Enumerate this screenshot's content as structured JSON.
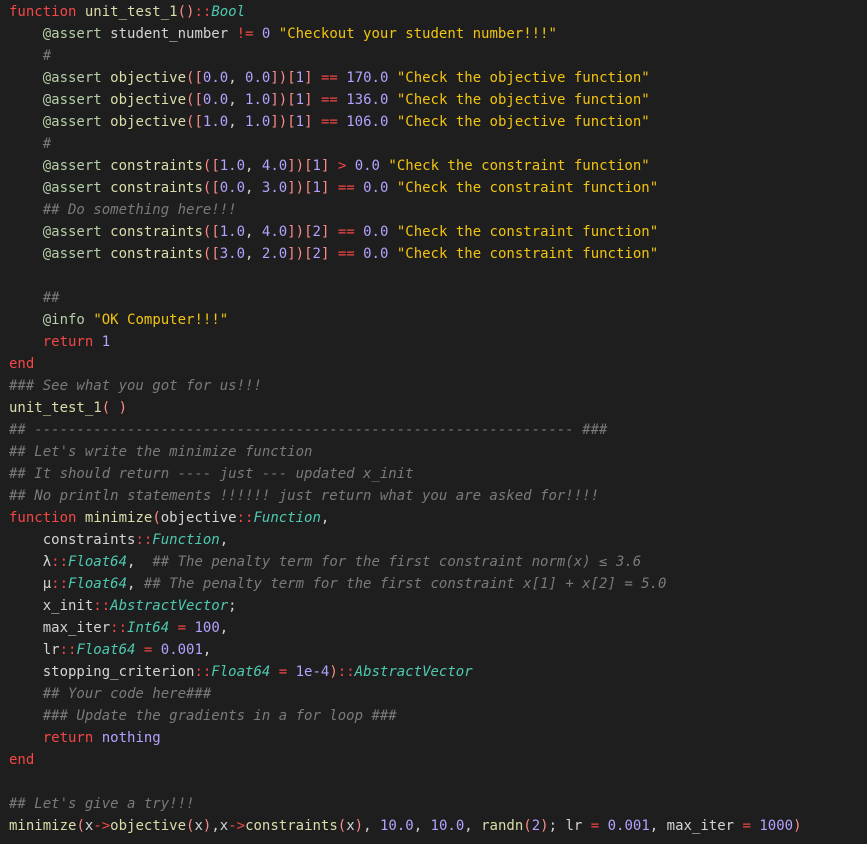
{
  "editor": {
    "language": "julia",
    "theme_colors": {
      "background": "#1e1e1e",
      "keyword": "#f44747",
      "function": "#dcdcaa",
      "type": "#4ec9b0",
      "macro": "#b5cea8",
      "string": "#f1c40f",
      "number": "#b5a1ff",
      "comment": "#7a7a7a",
      "text": "#d4d4d4"
    },
    "lines": [
      [
        [
          "kw",
          "function"
        ],
        [
          "id",
          " "
        ],
        [
          "fn",
          "unit_test_1"
        ],
        [
          "pun",
          "()"
        ],
        [
          "op",
          "::"
        ],
        [
          "typ",
          "Bool"
        ]
      ],
      [
        [
          "id",
          "    "
        ],
        [
          "mac",
          "@assert"
        ],
        [
          "id",
          " student_number "
        ],
        [
          "op",
          "!="
        ],
        [
          "id",
          " "
        ],
        [
          "num",
          "0"
        ],
        [
          "id",
          " "
        ],
        [
          "str",
          "\"Checkout your student number!!!\""
        ]
      ],
      [
        [
          "id",
          "    "
        ],
        [
          "cmt",
          "#"
        ]
      ],
      [
        [
          "id",
          "    "
        ],
        [
          "mac",
          "@assert"
        ],
        [
          "id",
          " "
        ],
        [
          "fn",
          "objective"
        ],
        [
          "pun",
          "(["
        ],
        [
          "num",
          "0.0"
        ],
        [
          "id",
          ", "
        ],
        [
          "num",
          "0.0"
        ],
        [
          "pun",
          "])"
        ],
        [
          "pun",
          "["
        ],
        [
          "num",
          "1"
        ],
        [
          "pun",
          "]"
        ],
        [
          "id",
          " "
        ],
        [
          "op",
          "=="
        ],
        [
          "id",
          " "
        ],
        [
          "num",
          "170.0"
        ],
        [
          "id",
          " "
        ],
        [
          "str",
          "\"Check the objective function\""
        ]
      ],
      [
        [
          "id",
          "    "
        ],
        [
          "mac",
          "@assert"
        ],
        [
          "id",
          " "
        ],
        [
          "fn",
          "objective"
        ],
        [
          "pun",
          "(["
        ],
        [
          "num",
          "0.0"
        ],
        [
          "id",
          ", "
        ],
        [
          "num",
          "1.0"
        ],
        [
          "pun",
          "])"
        ],
        [
          "pun",
          "["
        ],
        [
          "num",
          "1"
        ],
        [
          "pun",
          "]"
        ],
        [
          "id",
          " "
        ],
        [
          "op",
          "=="
        ],
        [
          "id",
          " "
        ],
        [
          "num",
          "136.0"
        ],
        [
          "id",
          " "
        ],
        [
          "str",
          "\"Check the objective function\""
        ]
      ],
      [
        [
          "id",
          "    "
        ],
        [
          "mac",
          "@assert"
        ],
        [
          "id",
          " "
        ],
        [
          "fn",
          "objective"
        ],
        [
          "pun",
          "(["
        ],
        [
          "num",
          "1.0"
        ],
        [
          "id",
          ", "
        ],
        [
          "num",
          "1.0"
        ],
        [
          "pun",
          "])"
        ],
        [
          "pun",
          "["
        ],
        [
          "num",
          "1"
        ],
        [
          "pun",
          "]"
        ],
        [
          "id",
          " "
        ],
        [
          "op",
          "=="
        ],
        [
          "id",
          " "
        ],
        [
          "num",
          "106.0"
        ],
        [
          "id",
          " "
        ],
        [
          "str",
          "\"Check the objective function\""
        ]
      ],
      [
        [
          "id",
          "    "
        ],
        [
          "cmt",
          "#"
        ]
      ],
      [
        [
          "id",
          "    "
        ],
        [
          "mac",
          "@assert"
        ],
        [
          "id",
          " "
        ],
        [
          "fn",
          "constraints"
        ],
        [
          "pun",
          "(["
        ],
        [
          "num",
          "1.0"
        ],
        [
          "id",
          ", "
        ],
        [
          "num",
          "4.0"
        ],
        [
          "pun",
          "])"
        ],
        [
          "pun",
          "["
        ],
        [
          "num",
          "1"
        ],
        [
          "pun",
          "]"
        ],
        [
          "id",
          " "
        ],
        [
          "op",
          ">"
        ],
        [
          "id",
          " "
        ],
        [
          "num",
          "0.0"
        ],
        [
          "id",
          " "
        ],
        [
          "str",
          "\"Check the constraint function\""
        ]
      ],
      [
        [
          "id",
          "    "
        ],
        [
          "mac",
          "@assert"
        ],
        [
          "id",
          " "
        ],
        [
          "fn",
          "constraints"
        ],
        [
          "pun",
          "(["
        ],
        [
          "num",
          "0.0"
        ],
        [
          "id",
          ", "
        ],
        [
          "num",
          "3.0"
        ],
        [
          "pun",
          "])"
        ],
        [
          "pun",
          "["
        ],
        [
          "num",
          "1"
        ],
        [
          "pun",
          "]"
        ],
        [
          "id",
          " "
        ],
        [
          "op",
          "=="
        ],
        [
          "id",
          " "
        ],
        [
          "num",
          "0.0"
        ],
        [
          "id",
          " "
        ],
        [
          "str",
          "\"Check the constraint function\""
        ]
      ],
      [
        [
          "id",
          "    "
        ],
        [
          "cmt",
          "## Do something here!!!"
        ]
      ],
      [
        [
          "id",
          "    "
        ],
        [
          "mac",
          "@assert"
        ],
        [
          "id",
          " "
        ],
        [
          "fn",
          "constraints"
        ],
        [
          "pun",
          "(["
        ],
        [
          "num",
          "1.0"
        ],
        [
          "id",
          ", "
        ],
        [
          "num",
          "4.0"
        ],
        [
          "pun",
          "])"
        ],
        [
          "pun",
          "["
        ],
        [
          "num",
          "2"
        ],
        [
          "pun",
          "]"
        ],
        [
          "id",
          " "
        ],
        [
          "op",
          "=="
        ],
        [
          "id",
          " "
        ],
        [
          "num",
          "0.0"
        ],
        [
          "id",
          " "
        ],
        [
          "str",
          "\"Check the constraint function\""
        ]
      ],
      [
        [
          "id",
          "    "
        ],
        [
          "mac",
          "@assert"
        ],
        [
          "id",
          " "
        ],
        [
          "fn",
          "constraints"
        ],
        [
          "pun",
          "(["
        ],
        [
          "num",
          "3.0"
        ],
        [
          "id",
          ", "
        ],
        [
          "num",
          "2.0"
        ],
        [
          "pun",
          "])"
        ],
        [
          "pun",
          "["
        ],
        [
          "num",
          "2"
        ],
        [
          "pun",
          "]"
        ],
        [
          "id",
          " "
        ],
        [
          "op",
          "=="
        ],
        [
          "id",
          " "
        ],
        [
          "num",
          "0.0"
        ],
        [
          "id",
          " "
        ],
        [
          "str",
          "\"Check the constraint function\""
        ]
      ],
      [],
      [
        [
          "id",
          "    "
        ],
        [
          "cmt",
          "##"
        ]
      ],
      [
        [
          "id",
          "    "
        ],
        [
          "mac",
          "@info"
        ],
        [
          "id",
          " "
        ],
        [
          "str",
          "\"OK Computer!!!\""
        ]
      ],
      [
        [
          "id",
          "    "
        ],
        [
          "kw",
          "return"
        ],
        [
          "id",
          " "
        ],
        [
          "num",
          "1"
        ]
      ],
      [
        [
          "kw",
          "end"
        ]
      ],
      [
        [
          "cmt",
          "### See what you got for us!!!"
        ]
      ],
      [
        [
          "fn",
          "unit_test_1"
        ],
        [
          "pun",
          "( )"
        ]
      ],
      [
        [
          "cmt",
          "## ---------------------------------------------------------------- ###"
        ]
      ],
      [
        [
          "cmt",
          "## Let's write the minimize function"
        ]
      ],
      [
        [
          "cmt",
          "## It should return ---- just --- updated x_init"
        ]
      ],
      [
        [
          "cmt",
          "## No println statements !!!!!! just return what you are asked for!!!!"
        ]
      ],
      [
        [
          "kw",
          "function"
        ],
        [
          "id",
          " "
        ],
        [
          "fn",
          "minimize"
        ],
        [
          "pun",
          "("
        ],
        [
          "id",
          "objective"
        ],
        [
          "op",
          "::"
        ],
        [
          "typ",
          "Function"
        ],
        [
          "id",
          ","
        ]
      ],
      [
        [
          "id",
          "    constraints"
        ],
        [
          "op",
          "::"
        ],
        [
          "typ",
          "Function"
        ],
        [
          "id",
          ","
        ]
      ],
      [
        [
          "id",
          "    λ"
        ],
        [
          "op",
          "::"
        ],
        [
          "typ",
          "Float64"
        ],
        [
          "id",
          ",  "
        ],
        [
          "cmt",
          "## The penalty term for the first constraint norm(x) ≤ 3.6"
        ]
      ],
      [
        [
          "id",
          "    μ"
        ],
        [
          "op",
          "::"
        ],
        [
          "typ",
          "Float64"
        ],
        [
          "id",
          ", "
        ],
        [
          "cmt",
          "## The penalty term for the first constraint x[1] + x[2] = 5.0"
        ]
      ],
      [
        [
          "id",
          "    x_init"
        ],
        [
          "op",
          "::"
        ],
        [
          "typ",
          "AbstractVector"
        ],
        [
          "id",
          ";"
        ]
      ],
      [
        [
          "id",
          "    max_iter"
        ],
        [
          "op",
          "::"
        ],
        [
          "typ",
          "Int64"
        ],
        [
          "id",
          " "
        ],
        [
          "op",
          "="
        ],
        [
          "id",
          " "
        ],
        [
          "num",
          "100"
        ],
        [
          "id",
          ","
        ]
      ],
      [
        [
          "id",
          "    lr"
        ],
        [
          "op",
          "::"
        ],
        [
          "typ",
          "Float64"
        ],
        [
          "id",
          " "
        ],
        [
          "op",
          "="
        ],
        [
          "id",
          " "
        ],
        [
          "num",
          "0.001"
        ],
        [
          "id",
          ","
        ]
      ],
      [
        [
          "id",
          "    stopping_criterion"
        ],
        [
          "op",
          "::"
        ],
        [
          "typ",
          "Float64"
        ],
        [
          "id",
          " "
        ],
        [
          "op",
          "="
        ],
        [
          "id",
          " "
        ],
        [
          "num",
          "1e-4"
        ],
        [
          "pun",
          ")"
        ],
        [
          "op",
          "::"
        ],
        [
          "typ",
          "AbstractVector"
        ]
      ],
      [
        [
          "id",
          "    "
        ],
        [
          "cmt",
          "## Your code here###"
        ]
      ],
      [
        [
          "id",
          "    "
        ],
        [
          "cmt",
          "### Update the gradients in a for loop ###"
        ]
      ],
      [
        [
          "id",
          "    "
        ],
        [
          "kw",
          "return"
        ],
        [
          "id",
          " "
        ],
        [
          "num",
          "nothing"
        ]
      ],
      [
        [
          "kw",
          "end"
        ]
      ],
      [],
      [
        [
          "cmt",
          "## Let's give a try!!!"
        ]
      ],
      [
        [
          "fn",
          "minimize"
        ],
        [
          "pun",
          "("
        ],
        [
          "id",
          "x"
        ],
        [
          "op",
          "->"
        ],
        [
          "fn",
          "objective"
        ],
        [
          "pun",
          "("
        ],
        [
          "id",
          "x"
        ],
        [
          "pun",
          ")"
        ],
        [
          "id",
          ","
        ],
        [
          "id",
          "x"
        ],
        [
          "op",
          "->"
        ],
        [
          "fn",
          "constraints"
        ],
        [
          "pun",
          "("
        ],
        [
          "id",
          "x"
        ],
        [
          "pun",
          ")"
        ],
        [
          "id",
          ", "
        ],
        [
          "num",
          "10.0"
        ],
        [
          "id",
          ", "
        ],
        [
          "num",
          "10.0"
        ],
        [
          "id",
          ", "
        ],
        [
          "fn",
          "randn"
        ],
        [
          "pun",
          "("
        ],
        [
          "num",
          "2"
        ],
        [
          "pun",
          ")"
        ],
        [
          "id",
          "; lr "
        ],
        [
          "op",
          "="
        ],
        [
          "id",
          " "
        ],
        [
          "num",
          "0.001"
        ],
        [
          "id",
          ", max_iter "
        ],
        [
          "op",
          "="
        ],
        [
          "id",
          " "
        ],
        [
          "num",
          "1000"
        ],
        [
          "pun",
          ")"
        ]
      ]
    ]
  }
}
